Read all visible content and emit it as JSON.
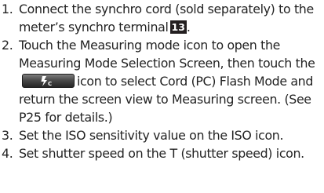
{
  "steps": [
    {
      "number": "1.",
      "text_before": "Connect the synchro cord (sold separately) to the meter’s synchro terminal",
      "ref_box": "13",
      "text_after": "."
    },
    {
      "number": "2.",
      "text_before": "Touch the Measuring mode icon to open the Measuring Mode Selection Screen, then touch the",
      "icon_name": "cord-pc-flash-mode-icon",
      "text_after": "icon to select Cord (PC) Flash Mode and return the screen view to Measuring screen. (See P25 for details.)"
    },
    {
      "number": "3.",
      "text": "Set the ISO sensitivity value on the ISO icon."
    },
    {
      "number": "4.",
      "text": "Set shutter speed on the T (shutter speed) icon."
    }
  ],
  "colors": {
    "text": "#222222",
    "ref_box_bg": "#231f20",
    "ref_box_text": "#ffffff",
    "icon_dark": "#262626",
    "icon_light": "#7d7d7d"
  }
}
